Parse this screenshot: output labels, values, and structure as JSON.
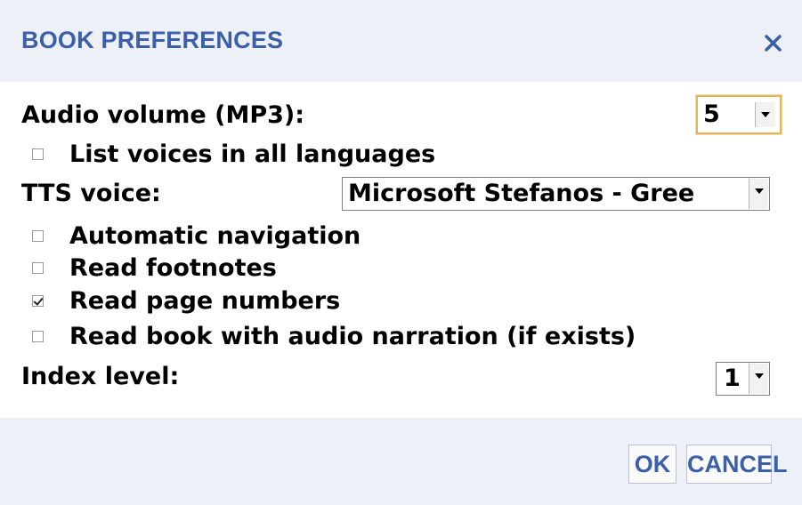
{
  "dialog": {
    "title": "BOOK PREFERENCES",
    "close_icon": "close-icon"
  },
  "form": {
    "audio_volume": {
      "label": "Audio volume (MP3):",
      "value": "5"
    },
    "list_voices": {
      "label": "List voices in all languages",
      "checked": false
    },
    "tts_voice": {
      "label": "TTS voice:",
      "value": "Microsoft Stefanos - Gree"
    },
    "automatic_navigation": {
      "label": "Automatic navigation",
      "checked": false
    },
    "read_footnotes": {
      "label": "Read footnotes",
      "checked": false
    },
    "read_page_numbers": {
      "label": "Read page numbers",
      "checked": true
    },
    "read_audio_narration": {
      "label": "Read book with audio narration (if exists)",
      "checked": false
    },
    "index_level": {
      "label": "Index level:",
      "value": "1"
    }
  },
  "buttons": {
    "ok": "OK",
    "cancel": "CANCEL"
  },
  "colors": {
    "title": "#3b5fa8",
    "header_bg": "#eef0f7",
    "focus_ring": "#e2b45c"
  }
}
